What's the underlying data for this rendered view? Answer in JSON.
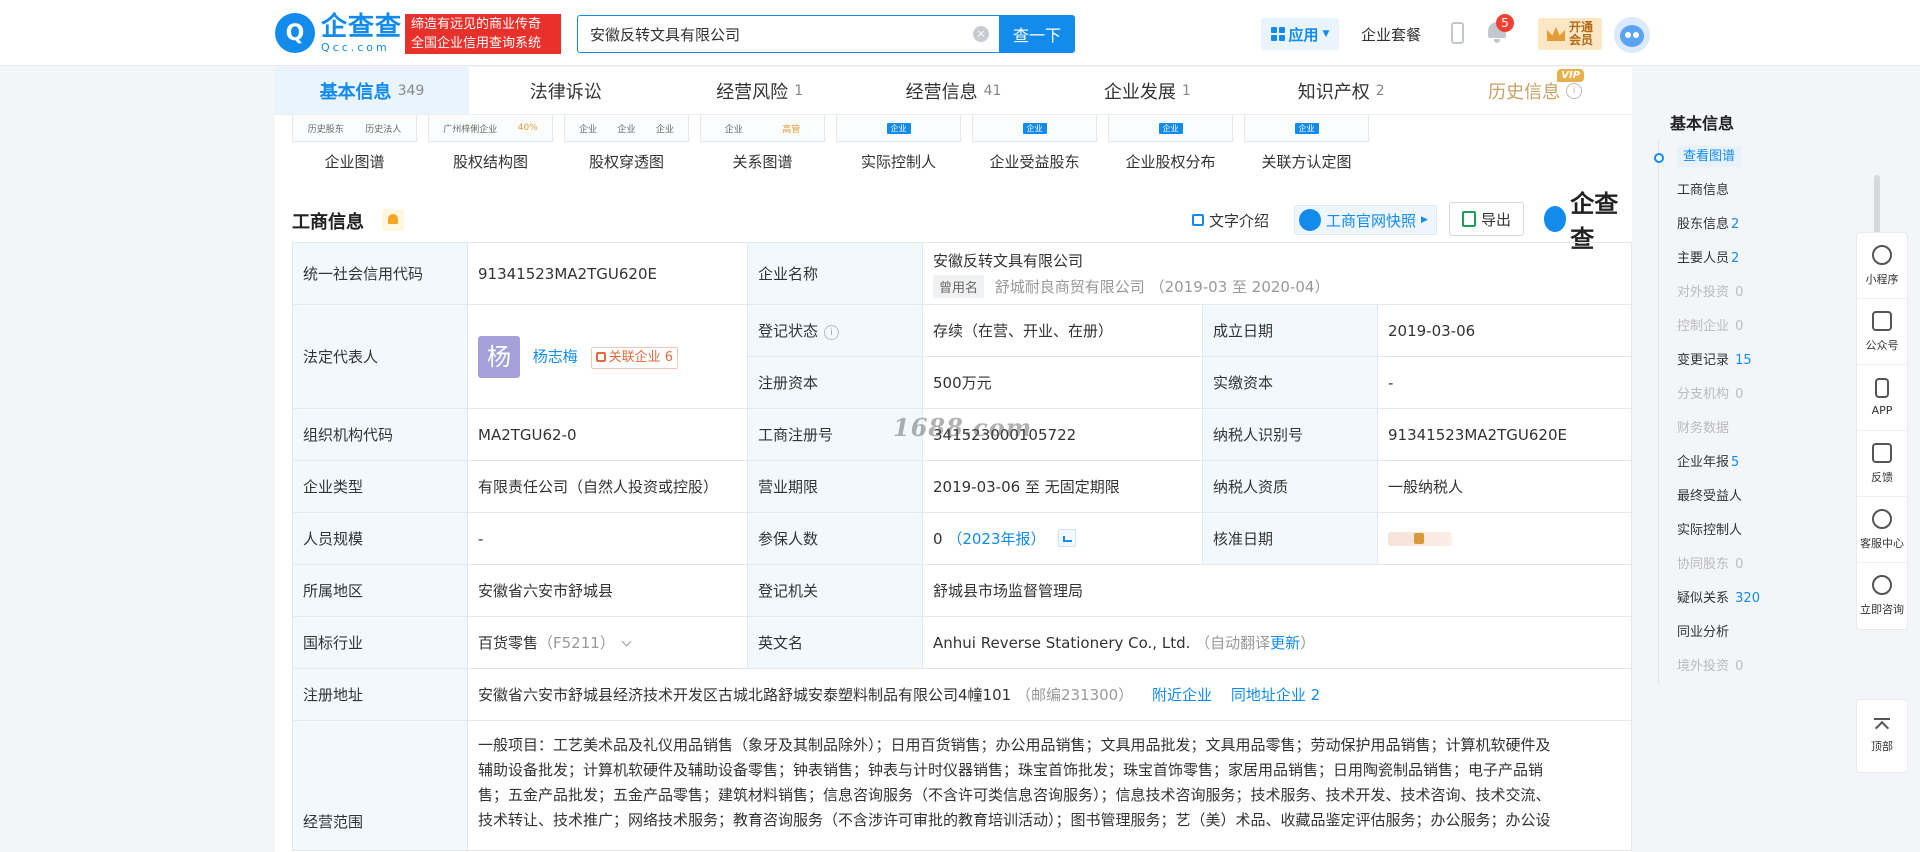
{
  "header": {
    "logo_cn": "企查查",
    "logo_en": "Qcc.com",
    "slogan_line1": "缔造有远见的商业传奇",
    "slogan_line2": "全国企业信用查询系统",
    "search_value": "安徽反转文具有限公司",
    "search_button": "查一下",
    "apps_label": "应用",
    "package_link": "企业套餐",
    "notification_count": "5",
    "vip_line1": "开通",
    "vip_line2": "会员"
  },
  "tabs": [
    {
      "label": "基本信息",
      "count": "349",
      "active": true
    },
    {
      "label": "法律诉讼",
      "count": ""
    },
    {
      "label": "经营风险",
      "count": "1"
    },
    {
      "label": "经营信息",
      "count": "41"
    },
    {
      "label": "企业发展",
      "count": "1"
    },
    {
      "label": "知识产权",
      "count": "2"
    },
    {
      "label": "历史信息",
      "count": "",
      "vip": "VIP"
    }
  ],
  "graphs": {
    "items": [
      "企业图谱",
      "股权结构图",
      "股权穿透图",
      "关系图谱",
      "实际控制人",
      "企业受益股东",
      "企业股权分布",
      "关联方认定图"
    ],
    "thumb_texts": {
      "t1a": "历史股东",
      "t1b": "历史法人",
      "t2a": "广州梓俐企业",
      "t2b": "40%",
      "t3a": "企业",
      "t3b": "企业",
      "t3c": "企业",
      "t4a": "企业",
      "t4b": "高管",
      "chip": "企业"
    }
  },
  "section": {
    "title": "工商信息",
    "text_intro": "文字介绍",
    "gsxt_snapshot": "工商官网快照",
    "export": "导出",
    "brand": "企查查"
  },
  "info": {
    "credit_code_label": "统一社会信用代码",
    "credit_code": "91341523MA2TGU620E",
    "name_label": "企业名称",
    "name": "安徽反转文具有限公司",
    "used_name_tag": "曾用名",
    "used_name": "舒城耐良商贸有限公司",
    "used_name_period": "（2019-03 至 2020-04）",
    "legal_rep_label": "法定代表人",
    "legal_rep_avatar": "杨",
    "legal_rep": "杨志梅",
    "related_company_label": "关联企业",
    "related_company_count": "6",
    "reg_status_label": "登记状态",
    "reg_status": "存续（在营、开业、在册）",
    "found_date_label": "成立日期",
    "found_date": "2019-03-06",
    "reg_capital_label": "注册资本",
    "reg_capital": "500万元",
    "paid_capital_label": "实缴资本",
    "paid_capital": "-",
    "org_code_label": "组织机构代码",
    "org_code": "MA2TGU62-0",
    "biz_reg_no_label": "工商注册号",
    "biz_reg_no": "341523000105722",
    "taxpayer_id_label": "纳税人识别号",
    "taxpayer_id": "91341523MA2TGU620E",
    "type_label": "企业类型",
    "type": "有限责任公司（自然人投资或控股）",
    "term_label": "营业期限",
    "term": "2019-03-06 至 无固定期限",
    "taxpayer_qual_label": "纳税人资质",
    "taxpayer_qual": "一般纳税人",
    "staff_size_label": "人员规模",
    "staff_size": "-",
    "insured_label": "参保人数",
    "insured": "0",
    "insured_report": "（2023年报）",
    "approval_date_label": "核准日期",
    "region_label": "所属地区",
    "region": "安徽省六安市舒城县",
    "reg_authority_label": "登记机关",
    "reg_authority": "舒城县市场监督管理局",
    "industry_label": "国标行业",
    "industry": "百货零售",
    "industry_code": "（F5211）",
    "english_name_label": "英文名",
    "english_name": "Anhui Reverse Stationery Co., Ltd.",
    "auto_translate": "（自动翻译",
    "update": "更新",
    "close_paren": "）",
    "address_label": "注册地址",
    "address": "安徽省六安市舒城县经济技术开发区古城北路舒城安泰塑料制品有限公司4幢101",
    "postcode": "（邮编231300）",
    "nearby": "附近企业",
    "same_address": "同地址企业",
    "same_address_count": "2",
    "scope_label": "经营范围",
    "scope_line1": "一般项目：工艺美术品及礼仪用品销售（象牙及其制品除外）；日用百货销售；办公用品销售；文具用品批发；文具用品零售；劳动保护用品销售；计算机软硬件及",
    "scope_line2": "辅助设备批发；计算机软硬件及辅助设备零售；钟表销售；钟表与计时仪器销售；珠宝首饰批发；珠宝首饰零售；家居用品销售；日用陶瓷制品销售；电子产品销",
    "scope_line3": "售；五金产品批发；五金产品零售；建筑材料销售；信息咨询服务（不含许可类信息咨询服务）；信息技术咨询服务；技术服务、技术开发、技术咨询、技术交流、",
    "scope_line4": "技术转让、技术推广；网络技术服务；教育咨询服务（不含涉许可审批的教育培训活动）；图书管理服务；艺（美）术品、收藏品鉴定评估服务；办公服务；办公设"
  },
  "watermark": "1688.com",
  "right_nav": {
    "title": "基本信息",
    "items": [
      {
        "label": "查看图谱",
        "count": "",
        "active": true
      },
      {
        "label": "工商信息",
        "count": ""
      },
      {
        "label": "股东信息",
        "count": "2"
      },
      {
        "label": "主要人员",
        "count": "2"
      },
      {
        "label": "对外投资",
        "count": "0",
        "dim": true
      },
      {
        "label": "控制企业",
        "count": "0",
        "dim": true
      },
      {
        "label": "变更记录",
        "count": "15"
      },
      {
        "label": "分支机构",
        "count": "0",
        "dim": true
      },
      {
        "label": "财务数据",
        "count": "",
        "dim": true
      },
      {
        "label": "企业年报",
        "count": "5"
      },
      {
        "label": "最终受益人",
        "count": ""
      },
      {
        "label": "实际控制人",
        "count": ""
      },
      {
        "label": "协同股东",
        "count": "0",
        "dim": true
      },
      {
        "label": "疑似关系",
        "count": "320"
      },
      {
        "label": "同业分析",
        "count": ""
      },
      {
        "label": "境外投资",
        "count": "0",
        "dim": true
      }
    ]
  },
  "tools": [
    "小程序",
    "公众号",
    "APP",
    "反馈",
    "客服中心",
    "立即咨询"
  ],
  "top_label": "顶部"
}
